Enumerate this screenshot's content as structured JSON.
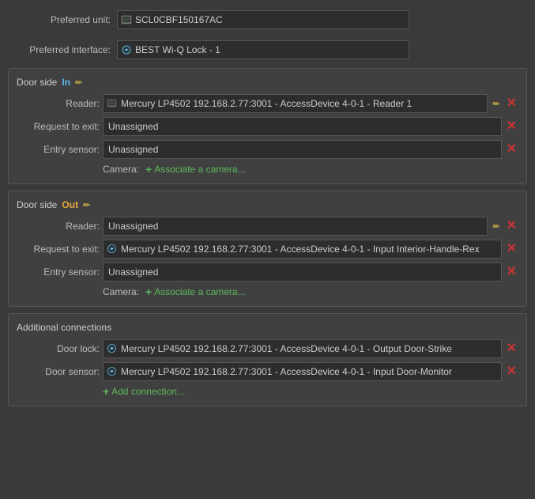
{
  "preferred": {
    "unit_label": "Preferred unit:",
    "unit_value": "SCL0CBF150167AC",
    "interface_label": "Preferred interface:",
    "interface_value": "BEST Wi-Q Lock - 1"
  },
  "door_side_in": {
    "title": "Door side",
    "side": "In",
    "reader_label": "Reader:",
    "reader_value": "Mercury LP4502 192.168.2.77:3001 - AccessDevice 4-0-1 - Reader 1",
    "rex_label": "Request to exit:",
    "rex_value": "Unassigned",
    "entry_label": "Entry sensor:",
    "entry_value": "Unassigned",
    "camera_label": "Camera:",
    "camera_btn": "Associate a camera..."
  },
  "door_side_out": {
    "title": "Door side",
    "side": "Out",
    "reader_label": "Reader:",
    "reader_value": "Unassigned",
    "rex_label": "Request to exit:",
    "rex_value": "Mercury LP4502 192.168.2.77:3001 - AccessDevice 4-0-1 - Input Interior-Handle-Rex",
    "entry_label": "Entry sensor:",
    "entry_value": "Unassigned",
    "camera_label": "Camera:",
    "camera_btn": "Associate a camera..."
  },
  "additional": {
    "title": "Additional connections",
    "door_lock_label": "Door lock:",
    "door_lock_value": "Mercury LP4502 192.168.2.77:3001 - AccessDevice 4-0-1 - Output Door-Strike",
    "door_sensor_label": "Door sensor:",
    "door_sensor_value": "Mercury LP4502 192.168.2.77:3001 - AccessDevice 4-0-1 - Input Door-Monitor",
    "add_connection_btn": "Add connection..."
  }
}
